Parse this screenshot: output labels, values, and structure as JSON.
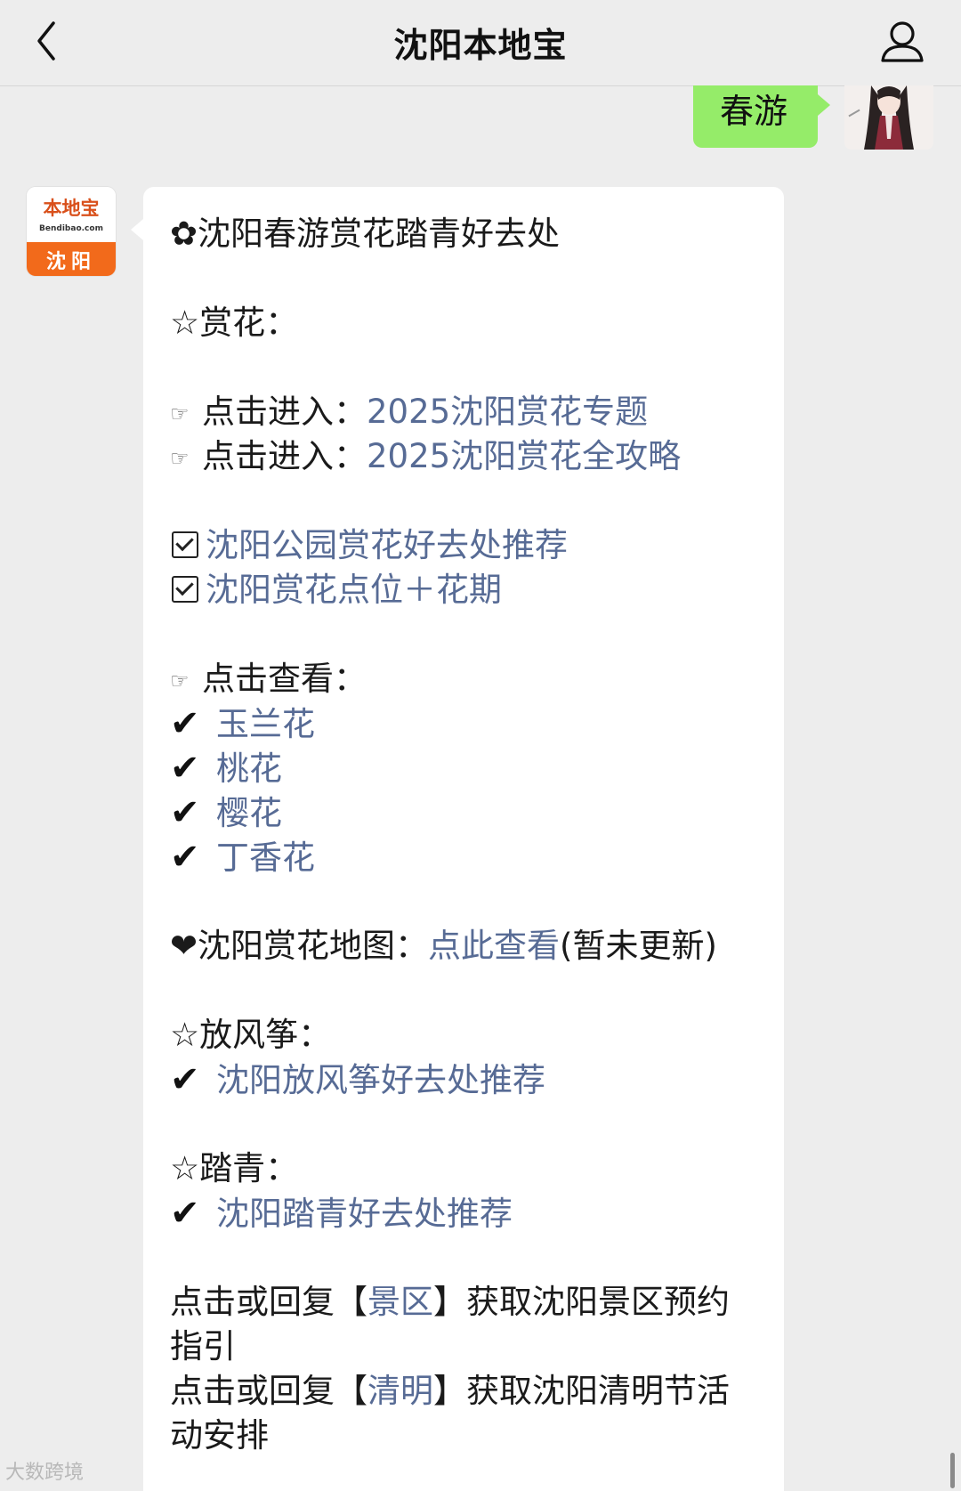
{
  "header": {
    "title": "沈阳本地宝",
    "back_icon": "chevron-left-icon",
    "profile_icon": "person-icon"
  },
  "outgoing": {
    "text": "春游"
  },
  "bot_avatar": {
    "logo": "本地宝",
    "domain": "Bendibao.com",
    "city": "沈阳"
  },
  "message": {
    "heading": "沈阳春游赏花踏青好去处",
    "section_flowers": "赏花：",
    "enter_prefix": "点击进入：",
    "link_topic": "2025沈阳赏花专题",
    "link_guide": "2025沈阳赏花全攻略",
    "link_parks": "沈阳公园赏花好去处推荐",
    "link_spots": "沈阳赏花点位＋花期",
    "view_label": "点击查看：",
    "flowers": [
      "玉兰花",
      "桃花",
      "樱花",
      "丁香花"
    ],
    "map_label": "沈阳赏花地图：",
    "map_link": "点此查看",
    "map_note": "(暂未更新)",
    "section_kite": "放风筝：",
    "kite_link": "沈阳放风筝好去处推荐",
    "section_walk": "踏青：",
    "walk_link": "沈阳踏青好去处推荐",
    "reply_prefix": "点击或回复【",
    "reply_mid": "】",
    "scenic_keyword": "景区",
    "scenic_suffix": "获取沈阳景区预约",
    "scenic_suffix2": "指引",
    "qingming_keyword": "清明",
    "qingming_suffix": "获取沈阳清明节活",
    "qingming_suffix2": "动安排"
  },
  "symbols": {
    "flower": "✿",
    "star": "☆",
    "hand": "☞",
    "check": "✔",
    "heart": "❤"
  },
  "watermark": "大数跨境",
  "colors": {
    "link": "#576b95",
    "bubble_green": "#95ec69",
    "background": "#ededed",
    "brand_orange": "#f26a1b"
  }
}
